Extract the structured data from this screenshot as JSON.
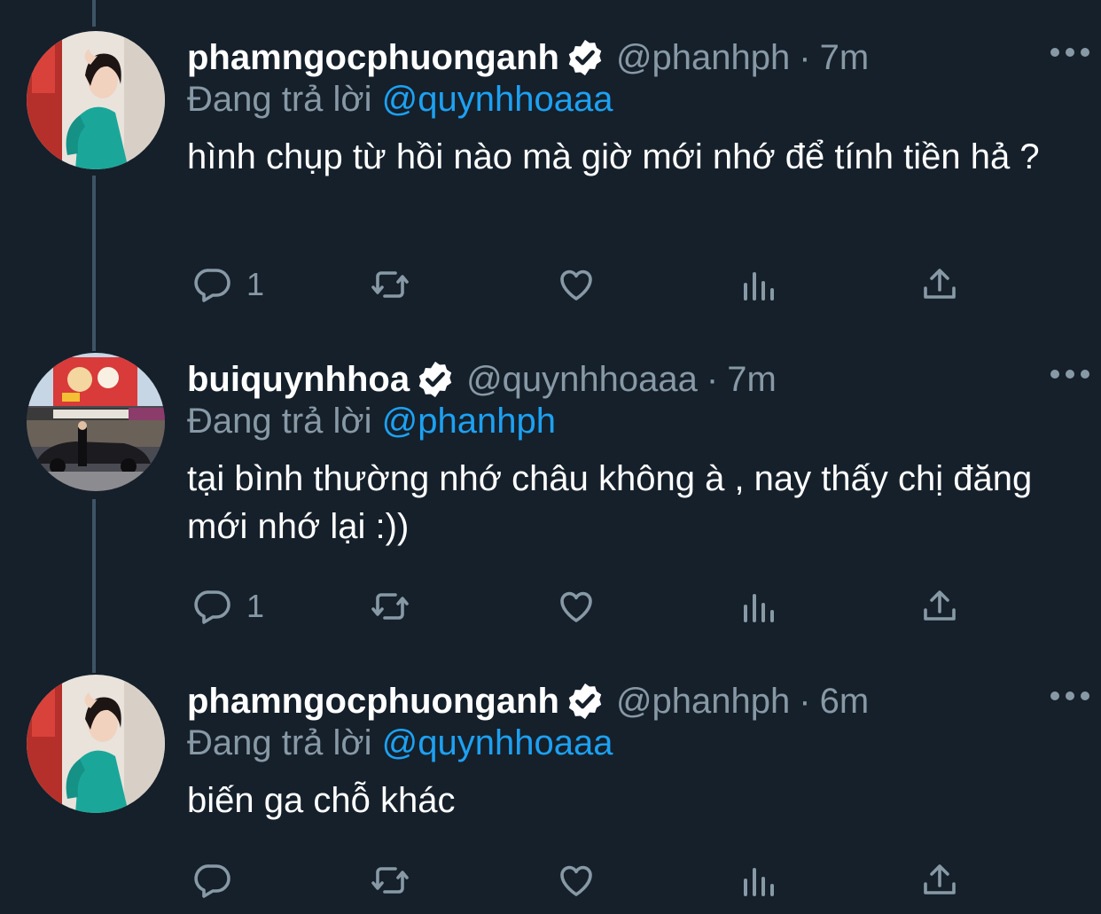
{
  "thread": {
    "tweets": [
      {
        "name": "phamngocphuonganh",
        "handle": "@phanhph",
        "separator": "·",
        "time": "7m",
        "replying_prefix": "Đang trả lời",
        "replying_to": "@quynhhoaaa",
        "text": "hình chụp từ hồi nào mà giờ mới nhớ để tính tiền hả ?",
        "reply_count": "1",
        "avatar_icon": "woman-in-teal-dress-avatar"
      },
      {
        "name": "buiquynhhoa",
        "handle": "@quynhhoaaa",
        "separator": "·",
        "time": "7m",
        "replying_prefix": "Đang trả lời",
        "replying_to": "@phanhph",
        "text": "tại bình thường nhớ châu không à , nay thấy chị đăng mới nhớ lại :))",
        "reply_count": "1",
        "avatar_icon": "street-storefront-avatar"
      },
      {
        "name": "phamngocphuonganh",
        "handle": "@phanhph",
        "separator": "·",
        "time": "6m",
        "replying_prefix": "Đang trả lời",
        "replying_to": "@quynhhoaaa",
        "text": "biến ga chỗ khác",
        "reply_count": "",
        "avatar_icon": "woman-in-teal-dress-avatar"
      }
    ]
  },
  "colors": {
    "background": "#15202b",
    "secondary_text": "#8899a6",
    "accent": "#1da1f2",
    "thread_line": "#3d5466"
  }
}
